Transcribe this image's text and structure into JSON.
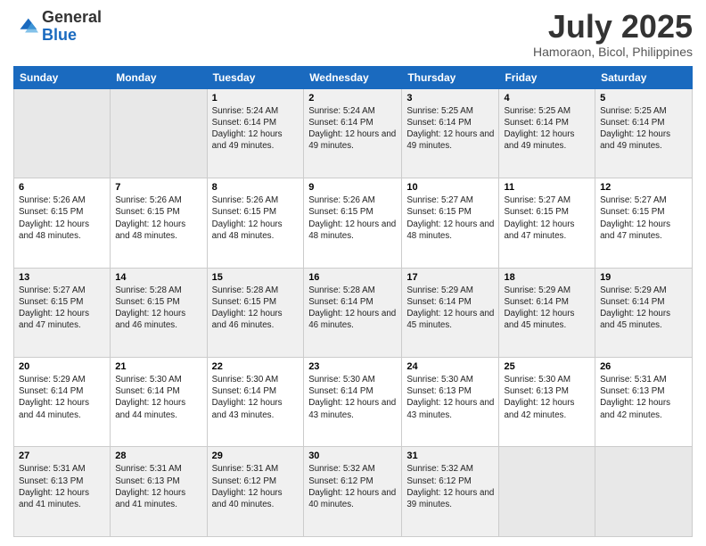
{
  "logo": {
    "general": "General",
    "blue": "Blue"
  },
  "header": {
    "month": "July 2025",
    "location": "Hamoraon, Bicol, Philippines"
  },
  "days": [
    "Sunday",
    "Monday",
    "Tuesday",
    "Wednesday",
    "Thursday",
    "Friday",
    "Saturday"
  ],
  "weeks": [
    [
      {
        "day": "",
        "content": ""
      },
      {
        "day": "",
        "content": ""
      },
      {
        "day": "1",
        "sunrise": "Sunrise: 5:24 AM",
        "sunset": "Sunset: 6:14 PM",
        "daylight": "Daylight: 12 hours and 49 minutes."
      },
      {
        "day": "2",
        "sunrise": "Sunrise: 5:24 AM",
        "sunset": "Sunset: 6:14 PM",
        "daylight": "Daylight: 12 hours and 49 minutes."
      },
      {
        "day": "3",
        "sunrise": "Sunrise: 5:25 AM",
        "sunset": "Sunset: 6:14 PM",
        "daylight": "Daylight: 12 hours and 49 minutes."
      },
      {
        "day": "4",
        "sunrise": "Sunrise: 5:25 AM",
        "sunset": "Sunset: 6:14 PM",
        "daylight": "Daylight: 12 hours and 49 minutes."
      },
      {
        "day": "5",
        "sunrise": "Sunrise: 5:25 AM",
        "sunset": "Sunset: 6:14 PM",
        "daylight": "Daylight: 12 hours and 49 minutes."
      }
    ],
    [
      {
        "day": "6",
        "sunrise": "Sunrise: 5:26 AM",
        "sunset": "Sunset: 6:15 PM",
        "daylight": "Daylight: 12 hours and 48 minutes."
      },
      {
        "day": "7",
        "sunrise": "Sunrise: 5:26 AM",
        "sunset": "Sunset: 6:15 PM",
        "daylight": "Daylight: 12 hours and 48 minutes."
      },
      {
        "day": "8",
        "sunrise": "Sunrise: 5:26 AM",
        "sunset": "Sunset: 6:15 PM",
        "daylight": "Daylight: 12 hours and 48 minutes."
      },
      {
        "day": "9",
        "sunrise": "Sunrise: 5:26 AM",
        "sunset": "Sunset: 6:15 PM",
        "daylight": "Daylight: 12 hours and 48 minutes."
      },
      {
        "day": "10",
        "sunrise": "Sunrise: 5:27 AM",
        "sunset": "Sunset: 6:15 PM",
        "daylight": "Daylight: 12 hours and 48 minutes."
      },
      {
        "day": "11",
        "sunrise": "Sunrise: 5:27 AM",
        "sunset": "Sunset: 6:15 PM",
        "daylight": "Daylight: 12 hours and 47 minutes."
      },
      {
        "day": "12",
        "sunrise": "Sunrise: 5:27 AM",
        "sunset": "Sunset: 6:15 PM",
        "daylight": "Daylight: 12 hours and 47 minutes."
      }
    ],
    [
      {
        "day": "13",
        "sunrise": "Sunrise: 5:27 AM",
        "sunset": "Sunset: 6:15 PM",
        "daylight": "Daylight: 12 hours and 47 minutes."
      },
      {
        "day": "14",
        "sunrise": "Sunrise: 5:28 AM",
        "sunset": "Sunset: 6:15 PM",
        "daylight": "Daylight: 12 hours and 46 minutes."
      },
      {
        "day": "15",
        "sunrise": "Sunrise: 5:28 AM",
        "sunset": "Sunset: 6:15 PM",
        "daylight": "Daylight: 12 hours and 46 minutes."
      },
      {
        "day": "16",
        "sunrise": "Sunrise: 5:28 AM",
        "sunset": "Sunset: 6:14 PM",
        "daylight": "Daylight: 12 hours and 46 minutes."
      },
      {
        "day": "17",
        "sunrise": "Sunrise: 5:29 AM",
        "sunset": "Sunset: 6:14 PM",
        "daylight": "Daylight: 12 hours and 45 minutes."
      },
      {
        "day": "18",
        "sunrise": "Sunrise: 5:29 AM",
        "sunset": "Sunset: 6:14 PM",
        "daylight": "Daylight: 12 hours and 45 minutes."
      },
      {
        "day": "19",
        "sunrise": "Sunrise: 5:29 AM",
        "sunset": "Sunset: 6:14 PM",
        "daylight": "Daylight: 12 hours and 45 minutes."
      }
    ],
    [
      {
        "day": "20",
        "sunrise": "Sunrise: 5:29 AM",
        "sunset": "Sunset: 6:14 PM",
        "daylight": "Daylight: 12 hours and 44 minutes."
      },
      {
        "day": "21",
        "sunrise": "Sunrise: 5:30 AM",
        "sunset": "Sunset: 6:14 PM",
        "daylight": "Daylight: 12 hours and 44 minutes."
      },
      {
        "day": "22",
        "sunrise": "Sunrise: 5:30 AM",
        "sunset": "Sunset: 6:14 PM",
        "daylight": "Daylight: 12 hours and 43 minutes."
      },
      {
        "day": "23",
        "sunrise": "Sunrise: 5:30 AM",
        "sunset": "Sunset: 6:14 PM",
        "daylight": "Daylight: 12 hours and 43 minutes."
      },
      {
        "day": "24",
        "sunrise": "Sunrise: 5:30 AM",
        "sunset": "Sunset: 6:13 PM",
        "daylight": "Daylight: 12 hours and 43 minutes."
      },
      {
        "day": "25",
        "sunrise": "Sunrise: 5:30 AM",
        "sunset": "Sunset: 6:13 PM",
        "daylight": "Daylight: 12 hours and 42 minutes."
      },
      {
        "day": "26",
        "sunrise": "Sunrise: 5:31 AM",
        "sunset": "Sunset: 6:13 PM",
        "daylight": "Daylight: 12 hours and 42 minutes."
      }
    ],
    [
      {
        "day": "27",
        "sunrise": "Sunrise: 5:31 AM",
        "sunset": "Sunset: 6:13 PM",
        "daylight": "Daylight: 12 hours and 41 minutes."
      },
      {
        "day": "28",
        "sunrise": "Sunrise: 5:31 AM",
        "sunset": "Sunset: 6:13 PM",
        "daylight": "Daylight: 12 hours and 41 minutes."
      },
      {
        "day": "29",
        "sunrise": "Sunrise: 5:31 AM",
        "sunset": "Sunset: 6:12 PM",
        "daylight": "Daylight: 12 hours and 40 minutes."
      },
      {
        "day": "30",
        "sunrise": "Sunrise: 5:32 AM",
        "sunset": "Sunset: 6:12 PM",
        "daylight": "Daylight: 12 hours and 40 minutes."
      },
      {
        "day": "31",
        "sunrise": "Sunrise: 5:32 AM",
        "sunset": "Sunset: 6:12 PM",
        "daylight": "Daylight: 12 hours and 39 minutes."
      },
      {
        "day": "",
        "content": ""
      },
      {
        "day": "",
        "content": ""
      }
    ]
  ]
}
